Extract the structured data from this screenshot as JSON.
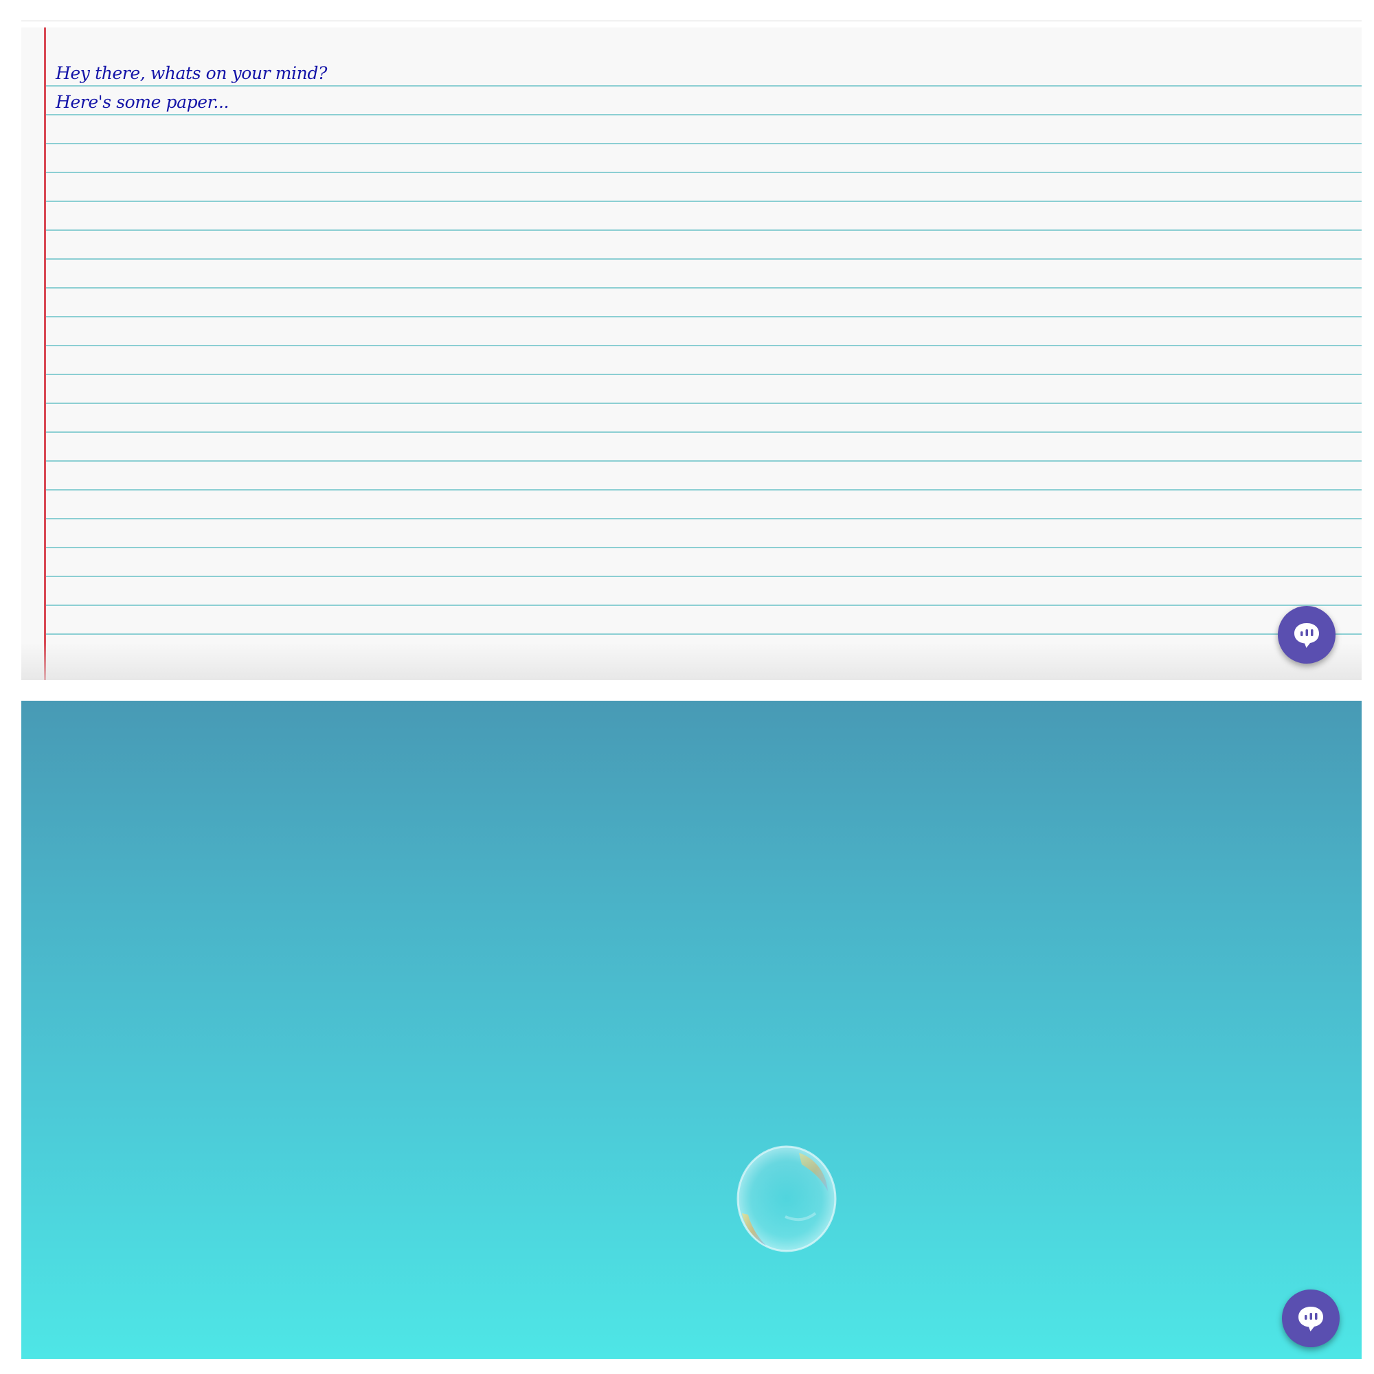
{
  "paper": {
    "lines": [
      "Hey there, whats on your mind?",
      "Here's some paper..."
    ],
    "ink_color": "#1414a8",
    "rule_color": "#8ccfd3",
    "margin_color": "#d84a55"
  },
  "chat_buttons": [
    {
      "icon": "chat-bubble-icon",
      "color": "#5a4fb0"
    },
    {
      "icon": "chat-bubble-icon",
      "color": "#5a4fb0"
    }
  ],
  "water_panel": {
    "gradient": [
      "#489ab5",
      "#4ee6e6"
    ],
    "image": "soap-bubble"
  }
}
